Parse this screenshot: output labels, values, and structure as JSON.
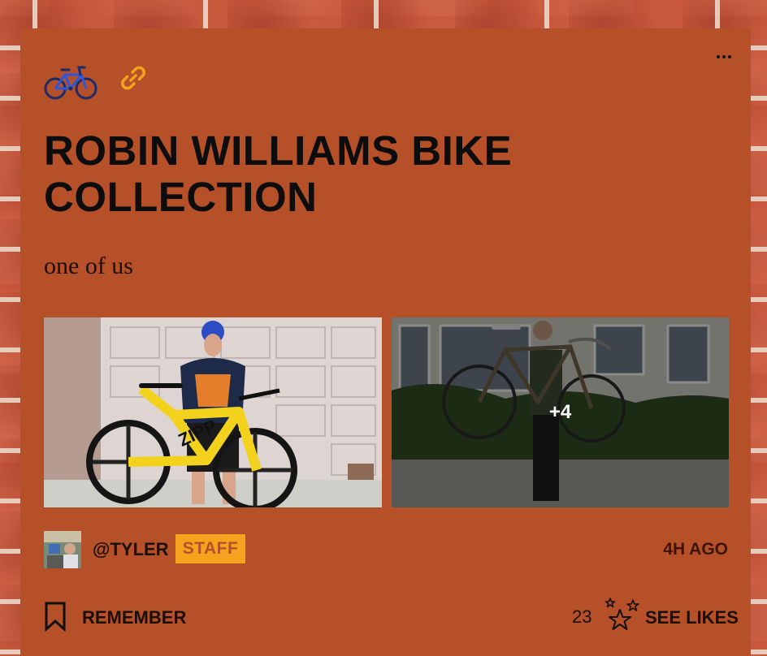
{
  "post": {
    "title": "ROBIN WILLIAMS BIKE COLLECTION",
    "subtitle": "one of us",
    "extra_photos_label": "+4"
  },
  "author": {
    "handle": "@TYLER",
    "badge": "STAFF",
    "posted_ago": "4H AGO"
  },
  "actions": {
    "remember_label": "REMEMBER",
    "likes_count": "23",
    "see_likes_label": "SEE LIKES"
  },
  "icons": [
    "bicycle-icon",
    "link-icon",
    "more-icon",
    "bookmark-icon",
    "stars-icon"
  ],
  "colors": {
    "card_background": "#b65028",
    "link_icon": "#f6a21f",
    "staff_badge": "#f6a21f",
    "text": "#0d0d0d"
  }
}
